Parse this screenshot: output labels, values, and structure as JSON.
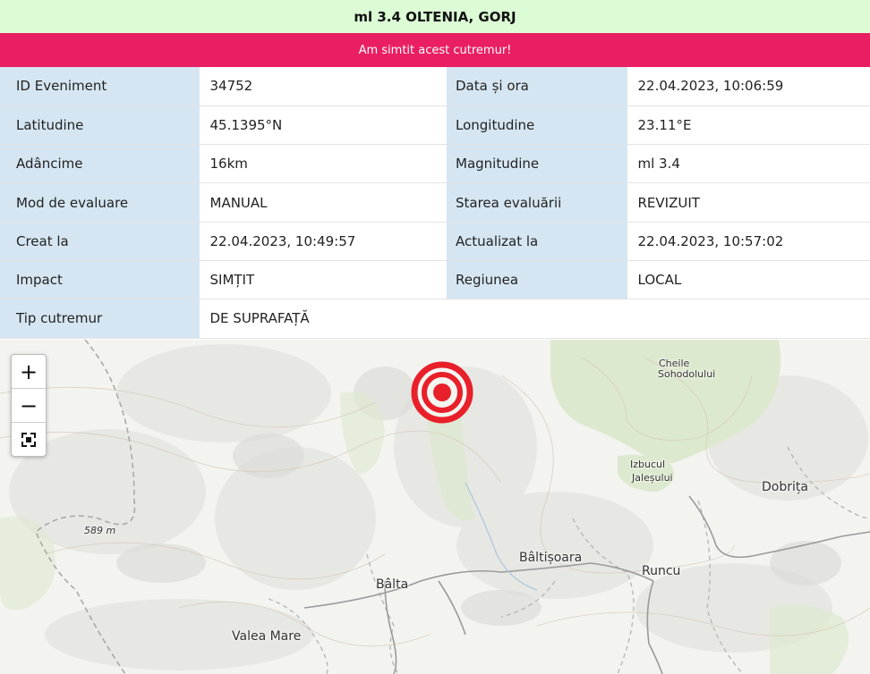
{
  "header": {
    "title": "ml 3.4 OLTENIA, GORJ"
  },
  "felt_button": {
    "label": "Am simtit acest cutremur!"
  },
  "details": {
    "rows": [
      {
        "k1": "ID Eveniment",
        "v1": "34752",
        "k2": "Data și ora",
        "v2": "22.04.2023, 10:06:59"
      },
      {
        "k1": "Latitudine",
        "v1": "45.1395°N",
        "k2": "Longitudine",
        "v2": "23.11°E"
      },
      {
        "k1": "Adâncime",
        "v1": "16km",
        "k2": "Magnitudine",
        "v2": "ml 3.4"
      },
      {
        "k1": "Mod de evaluare",
        "v1": "MANUAL",
        "k2": "Starea evaluării",
        "v2": "REVIZUIT"
      },
      {
        "k1": "Creat la",
        "v1": "22.04.2023, 10:49:57",
        "k2": "Actualizat la",
        "v2": "22.04.2023, 10:57:02"
      },
      {
        "k1": "Impact",
        "v1": "SIMȚIT",
        "k2": "Regiunea",
        "v2": "LOCAL"
      },
      {
        "k1": "Tip cutremur",
        "v1": "DE SUPRAFAȚĂ"
      }
    ]
  },
  "map": {
    "zoom_in": "+",
    "zoom_out": "−",
    "fullscreen_icon": "fullscreen-icon",
    "epicenter_color": "#e8202a",
    "labels": {
      "cheile_1": "Cheile",
      "cheile_2": "Sohodolului",
      "izbucul_1": "Izbucul",
      "izbucul_2": "Jaleșului",
      "dobrita": "Dobrița",
      "elevation": "589 m",
      "baltisoara": "Bâltișoara",
      "runcu": "Runcu",
      "balta": "Bâlta",
      "valea_mare": "Valea Mare"
    }
  }
}
